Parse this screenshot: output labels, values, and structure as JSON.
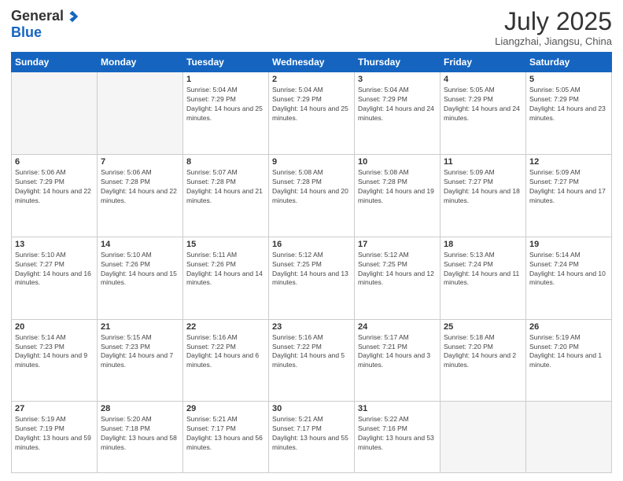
{
  "logo": {
    "general": "General",
    "blue": "Blue"
  },
  "title": "July 2025",
  "location": "Liangzhai, Jiangsu, China",
  "weekdays": [
    "Sunday",
    "Monday",
    "Tuesday",
    "Wednesday",
    "Thursday",
    "Friday",
    "Saturday"
  ],
  "weeks": [
    [
      {
        "day": "",
        "info": ""
      },
      {
        "day": "",
        "info": ""
      },
      {
        "day": "1",
        "info": "Sunrise: 5:04 AM\nSunset: 7:29 PM\nDaylight: 14 hours and 25 minutes."
      },
      {
        "day": "2",
        "info": "Sunrise: 5:04 AM\nSunset: 7:29 PM\nDaylight: 14 hours and 25 minutes."
      },
      {
        "day": "3",
        "info": "Sunrise: 5:04 AM\nSunset: 7:29 PM\nDaylight: 14 hours and 24 minutes."
      },
      {
        "day": "4",
        "info": "Sunrise: 5:05 AM\nSunset: 7:29 PM\nDaylight: 14 hours and 24 minutes."
      },
      {
        "day": "5",
        "info": "Sunrise: 5:05 AM\nSunset: 7:29 PM\nDaylight: 14 hours and 23 minutes."
      }
    ],
    [
      {
        "day": "6",
        "info": "Sunrise: 5:06 AM\nSunset: 7:29 PM\nDaylight: 14 hours and 22 minutes."
      },
      {
        "day": "7",
        "info": "Sunrise: 5:06 AM\nSunset: 7:28 PM\nDaylight: 14 hours and 22 minutes."
      },
      {
        "day": "8",
        "info": "Sunrise: 5:07 AM\nSunset: 7:28 PM\nDaylight: 14 hours and 21 minutes."
      },
      {
        "day": "9",
        "info": "Sunrise: 5:08 AM\nSunset: 7:28 PM\nDaylight: 14 hours and 20 minutes."
      },
      {
        "day": "10",
        "info": "Sunrise: 5:08 AM\nSunset: 7:28 PM\nDaylight: 14 hours and 19 minutes."
      },
      {
        "day": "11",
        "info": "Sunrise: 5:09 AM\nSunset: 7:27 PM\nDaylight: 14 hours and 18 minutes."
      },
      {
        "day": "12",
        "info": "Sunrise: 5:09 AM\nSunset: 7:27 PM\nDaylight: 14 hours and 17 minutes."
      }
    ],
    [
      {
        "day": "13",
        "info": "Sunrise: 5:10 AM\nSunset: 7:27 PM\nDaylight: 14 hours and 16 minutes."
      },
      {
        "day": "14",
        "info": "Sunrise: 5:10 AM\nSunset: 7:26 PM\nDaylight: 14 hours and 15 minutes."
      },
      {
        "day": "15",
        "info": "Sunrise: 5:11 AM\nSunset: 7:26 PM\nDaylight: 14 hours and 14 minutes."
      },
      {
        "day": "16",
        "info": "Sunrise: 5:12 AM\nSunset: 7:25 PM\nDaylight: 14 hours and 13 minutes."
      },
      {
        "day": "17",
        "info": "Sunrise: 5:12 AM\nSunset: 7:25 PM\nDaylight: 14 hours and 12 minutes."
      },
      {
        "day": "18",
        "info": "Sunrise: 5:13 AM\nSunset: 7:24 PM\nDaylight: 14 hours and 11 minutes."
      },
      {
        "day": "19",
        "info": "Sunrise: 5:14 AM\nSunset: 7:24 PM\nDaylight: 14 hours and 10 minutes."
      }
    ],
    [
      {
        "day": "20",
        "info": "Sunrise: 5:14 AM\nSunset: 7:23 PM\nDaylight: 14 hours and 9 minutes."
      },
      {
        "day": "21",
        "info": "Sunrise: 5:15 AM\nSunset: 7:23 PM\nDaylight: 14 hours and 7 minutes."
      },
      {
        "day": "22",
        "info": "Sunrise: 5:16 AM\nSunset: 7:22 PM\nDaylight: 14 hours and 6 minutes."
      },
      {
        "day": "23",
        "info": "Sunrise: 5:16 AM\nSunset: 7:22 PM\nDaylight: 14 hours and 5 minutes."
      },
      {
        "day": "24",
        "info": "Sunrise: 5:17 AM\nSunset: 7:21 PM\nDaylight: 14 hours and 3 minutes."
      },
      {
        "day": "25",
        "info": "Sunrise: 5:18 AM\nSunset: 7:20 PM\nDaylight: 14 hours and 2 minutes."
      },
      {
        "day": "26",
        "info": "Sunrise: 5:19 AM\nSunset: 7:20 PM\nDaylight: 14 hours and 1 minute."
      }
    ],
    [
      {
        "day": "27",
        "info": "Sunrise: 5:19 AM\nSunset: 7:19 PM\nDaylight: 13 hours and 59 minutes."
      },
      {
        "day": "28",
        "info": "Sunrise: 5:20 AM\nSunset: 7:18 PM\nDaylight: 13 hours and 58 minutes."
      },
      {
        "day": "29",
        "info": "Sunrise: 5:21 AM\nSunset: 7:17 PM\nDaylight: 13 hours and 56 minutes."
      },
      {
        "day": "30",
        "info": "Sunrise: 5:21 AM\nSunset: 7:17 PM\nDaylight: 13 hours and 55 minutes."
      },
      {
        "day": "31",
        "info": "Sunrise: 5:22 AM\nSunset: 7:16 PM\nDaylight: 13 hours and 53 minutes."
      },
      {
        "day": "",
        "info": ""
      },
      {
        "day": "",
        "info": ""
      }
    ]
  ]
}
